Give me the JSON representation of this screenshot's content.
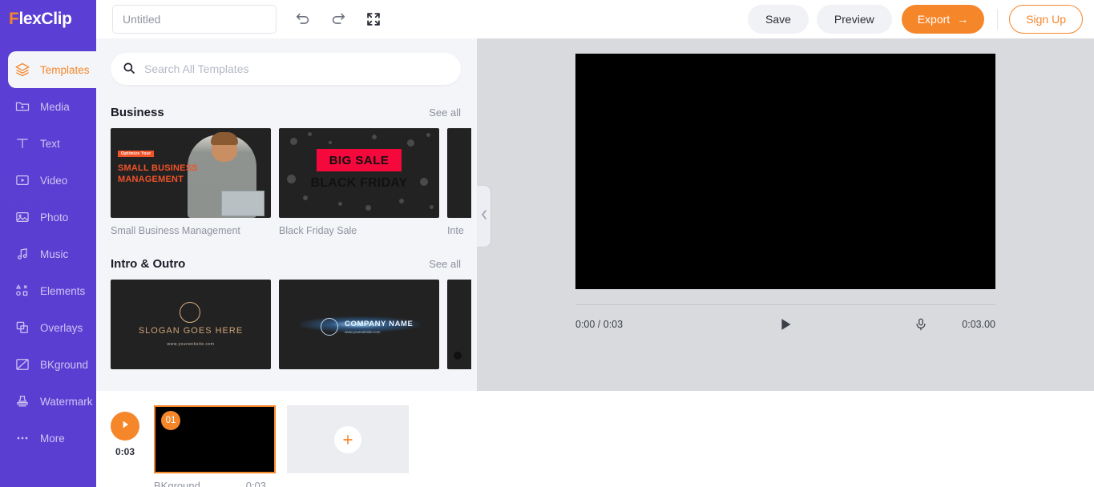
{
  "app": {
    "brand_prefix": "F",
    "brand_rest": "lexClip",
    "accent": "#f6862a",
    "sidebar_bg": "#5b3ed3"
  },
  "sidebar": {
    "items": [
      {
        "label": "Templates",
        "icon": "layers-icon",
        "active": true
      },
      {
        "label": "Media",
        "icon": "media-folder-icon",
        "active": false
      },
      {
        "label": "Text",
        "icon": "text-icon",
        "active": false
      },
      {
        "label": "Video",
        "icon": "video-icon",
        "active": false
      },
      {
        "label": "Photo",
        "icon": "photo-icon",
        "active": false
      },
      {
        "label": "Music",
        "icon": "music-icon",
        "active": false
      },
      {
        "label": "Elements",
        "icon": "elements-icon",
        "active": false
      },
      {
        "label": "Overlays",
        "icon": "overlays-icon",
        "active": false
      },
      {
        "label": "BKground",
        "icon": "background-icon",
        "active": false
      },
      {
        "label": "Watermark",
        "icon": "watermark-icon",
        "active": false
      },
      {
        "label": "More",
        "icon": "more-dots-icon",
        "active": false
      }
    ]
  },
  "topbar": {
    "project_title_value": "",
    "project_title_placeholder": "Untitled",
    "undo_icon": "undo-icon",
    "redo_icon": "redo-icon",
    "fullscreen_icon": "fullscreen-icon",
    "save_label": "Save",
    "preview_label": "Preview",
    "export_label": "Export",
    "export_arrow": "→",
    "signup_label": "Sign Up"
  },
  "panel": {
    "search_value": "",
    "search_placeholder": "Search All Templates",
    "search_icon": "search-icon",
    "collapse_icon": "chevron-left-icon",
    "sections": [
      {
        "title": "Business",
        "see_all": "See all",
        "items": [
          {
            "caption": "Small Business Management",
            "kicker": "Optimize Your",
            "headline": "SMALL BUSINESS\nMANAGEMENT"
          },
          {
            "caption": "Black Friday Sale",
            "sale_text": "BIG SALE",
            "sub_text": "BLACK FRIDAY"
          },
          {
            "caption": "Inte"
          }
        ]
      },
      {
        "title": "Intro & Outro",
        "see_all": "See all",
        "items": [
          {
            "caption": "",
            "slogan": "SLOGAN GOES HERE",
            "site": "www.yourwebsite.com"
          },
          {
            "caption": "",
            "company": "COMPANY NAME",
            "site": "www.yourwebsite.com"
          },
          {
            "caption": ""
          }
        ]
      }
    ]
  },
  "colorbar": {
    "swatches": [
      "#111111",
      "#ffffff",
      "#0cb395",
      "#8468e0",
      "#1295f0",
      "#fbb519",
      "#fa7ca8"
    ],
    "bucket_icon": "paint-bucket-icon",
    "clock_icon": "clock-icon"
  },
  "player": {
    "current_total": "0:00 / 0:03",
    "play_icon": "play-icon",
    "mic_icon": "microphone-icon",
    "duration": "0:03.00"
  },
  "timeline": {
    "play_icon": "play-icon",
    "total_time": "0:03",
    "scene": {
      "number": "01",
      "name": "BKground",
      "duration": "0:03"
    },
    "add_icon": "plus-icon"
  }
}
